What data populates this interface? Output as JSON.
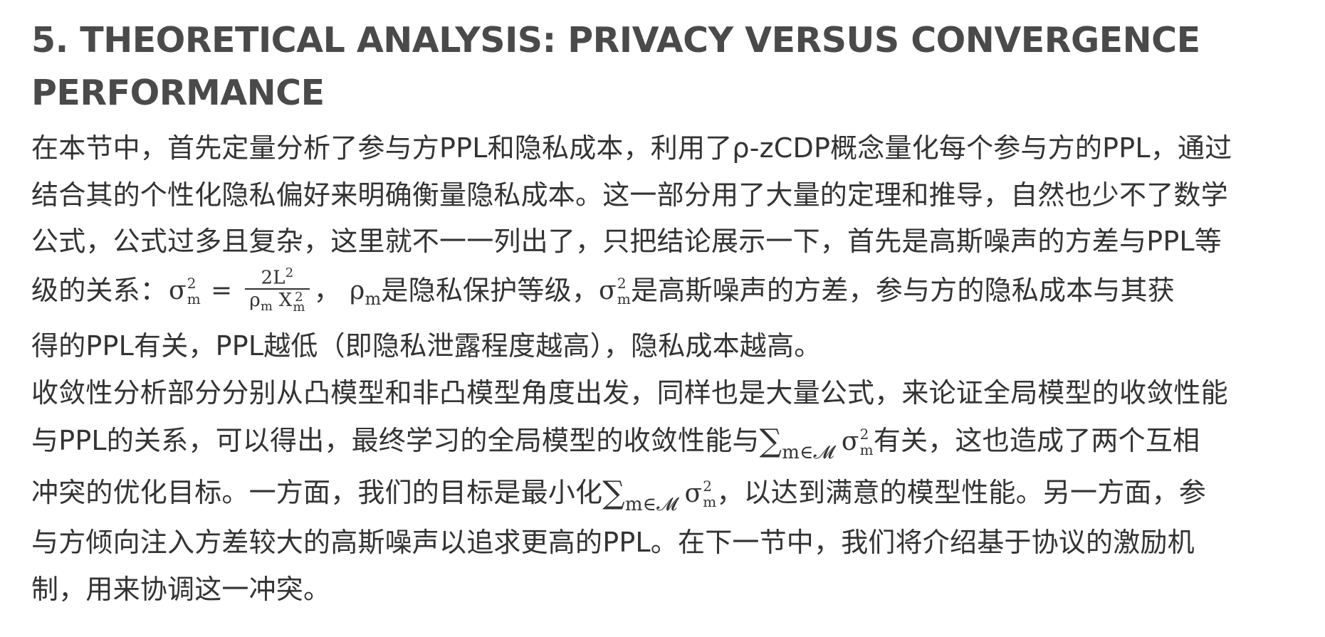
{
  "heading": {
    "line1": "5. THEORETICAL ANALYSIS: PRIVACY VERSUS CONVERGENCE",
    "line2": "PERFORMANCE"
  },
  "para1": {
    "line1": "在本节中，首先定量分析了参与方PPL和隐私成本，利用了ρ-zCDP概念量化每个参与方的PPL，通过",
    "line2": "结合其的个性化隐私偏好来明确衡量隐私成本。这一部分用了大量的定理和推导，自然也少不了数学",
    "line3": "公式，公式过多且复杂，这里就不一一列出了，只把结论展示一下，首先是高斯噪声的方差与PPL等",
    "line4_prefix": "级的关系：",
    "line4_after_formula": "，",
    "line4_mid": "是隐私保护等级，",
    "line4_suffix": "是高斯噪声的方差，参与方的隐私成本与其获",
    "line5": "得的PPL有关，PPL越低（即隐私泄露程度越高），隐私成本越高。"
  },
  "formula": {
    "sigma": "σ",
    "sub_m": "m",
    "sup_2": "2",
    "equals": "=",
    "num": "2L",
    "den_rho": "ρ",
    "den_x": "X",
    "rho": "ρ",
    "sum": "∑",
    "sum_sub": "m∈𝓜"
  },
  "para2": {
    "line1": "收敛性分析部分分别从凸模型和非凸模型角度出发，同样也是大量公式，来论证全局模型的收敛性能",
    "line2_prefix": "与PPL的关系，可以得出，最终学习的全局模型的收敛性能与",
    "line2_suffix": "有关，这也造成了两个互相",
    "line3_prefix": "冲突的优化目标。一方面，我们的目标是最小化",
    "line3_suffix": "，以达到满意的模型性能。另一方面，参",
    "line4": "与方倾向注入方差较大的高斯噪声以追求更高的PPL。在下一节中，我们将介绍基于协议的激励机",
    "line5": "制，用来协调这一冲突。"
  }
}
